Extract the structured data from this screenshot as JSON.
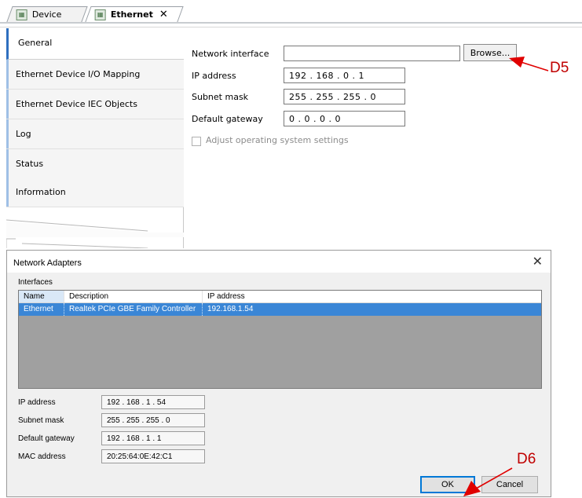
{
  "tabs": [
    {
      "label": "Device",
      "active": false
    },
    {
      "label": "Ethernet",
      "active": true,
      "close": "✕"
    }
  ],
  "sidebar": {
    "items": [
      {
        "label": "General",
        "active": true
      },
      {
        "label": "Ethernet Device I/O Mapping"
      },
      {
        "label": "Ethernet Device IEC Objects"
      },
      {
        "label": "Log"
      },
      {
        "label": "Status"
      },
      {
        "label": "Information"
      }
    ]
  },
  "form": {
    "network_interface_label": "Network interface",
    "network_interface_value": "",
    "browse_label": "Browse...",
    "ip_label": "IP address",
    "ip_value": "192 . 168 . 0 . 1",
    "subnet_label": "Subnet mask",
    "subnet_value": "255 . 255 . 255 . 0",
    "gateway_label": "Default gateway",
    "gateway_value": "0 . 0 . 0 . 0",
    "adjust_label": "Adjust operating system settings"
  },
  "annotations": {
    "d5": "D5",
    "d6": "D6",
    "arrow_color": "#e00000"
  },
  "dialog": {
    "title": "Network Adapters",
    "close": "✕",
    "interfaces_label": "Interfaces",
    "columns": [
      "Name",
      "Description",
      "IP address"
    ],
    "rows": [
      {
        "name": "Ethernet",
        "description": "Realtek PCIe GBE Family Controller",
        "ip": "192.168.1.54"
      }
    ],
    "ip_label": "IP address",
    "ip_value": "192 . 168 . 1 . 54",
    "subnet_label": "Subnet mask",
    "subnet_value": "255 . 255 . 255 . 0",
    "gateway_label": "Default gateway",
    "gateway_value": "192 . 168 . 1 . 1",
    "mac_label": "MAC address",
    "mac_value": "20:25:64:0E:42:C1",
    "ok_label": "OK",
    "cancel_label": "Cancel"
  }
}
